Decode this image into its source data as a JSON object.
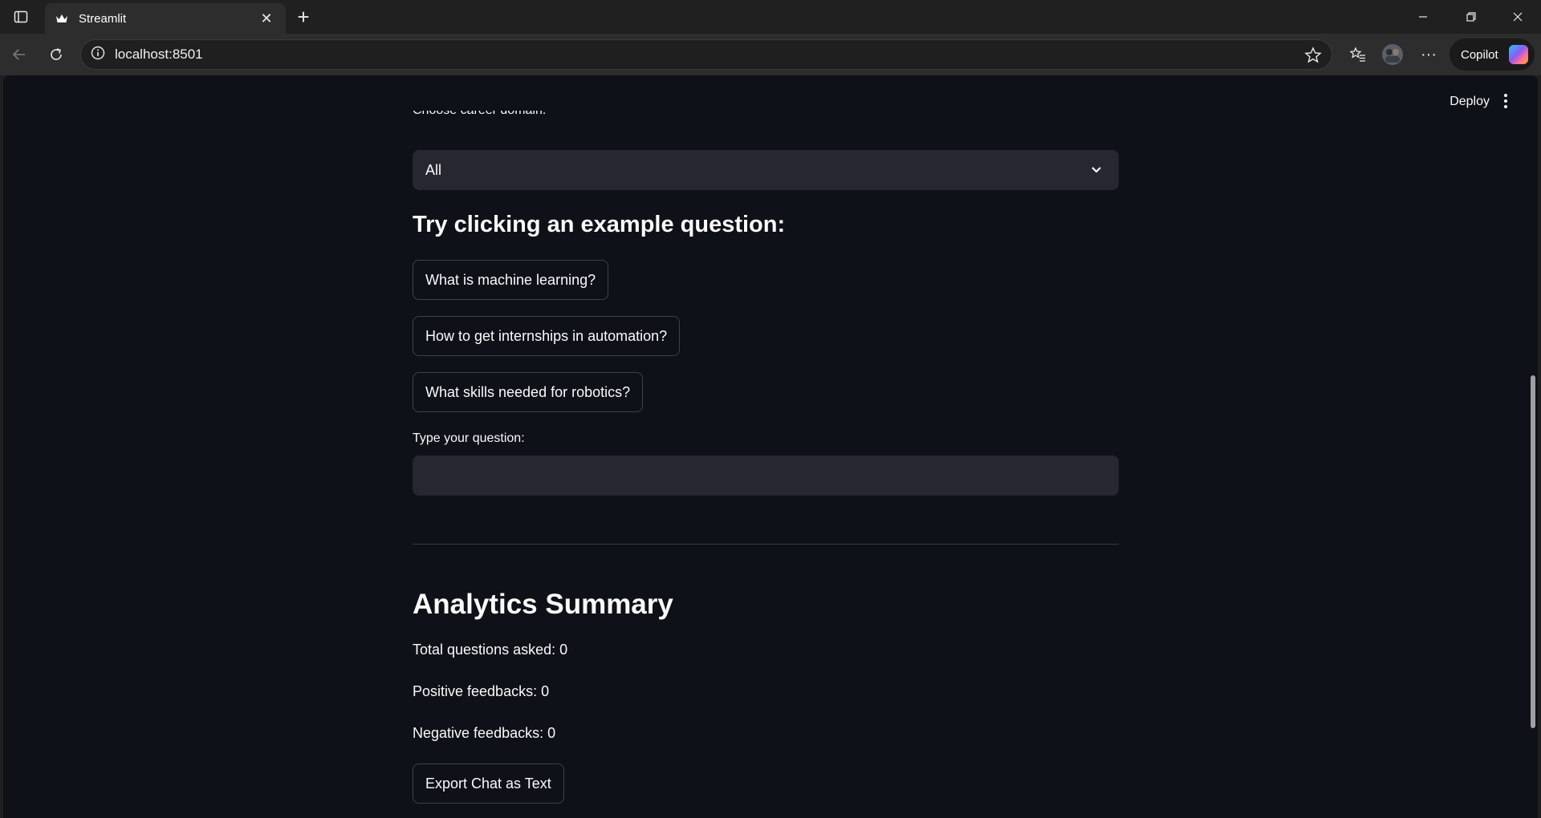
{
  "browser": {
    "tab_title": "Streamlit",
    "url": "localhost:8501",
    "copilot_label": "Copilot"
  },
  "header": {
    "deploy_label": "Deploy"
  },
  "main": {
    "domain_label": "Choose career domain:",
    "domain_selected": "All",
    "examples_heading": "Try clicking an example question:",
    "example_questions": [
      "What is machine learning?",
      "How to get internships in automation?",
      "What skills needed for robotics?"
    ],
    "question_label": "Type your question:",
    "question_value": "",
    "analytics_heading": "Analytics Summary",
    "total_questions": "Total questions asked: 0",
    "positive_feedbacks": "Positive feedbacks: 0",
    "negative_feedbacks": "Negative feedbacks: 0",
    "export_label": "Export Chat as Text"
  },
  "colors": {
    "page_bg": "#0e1117",
    "input_bg": "#262730",
    "text": "#fafafa"
  }
}
